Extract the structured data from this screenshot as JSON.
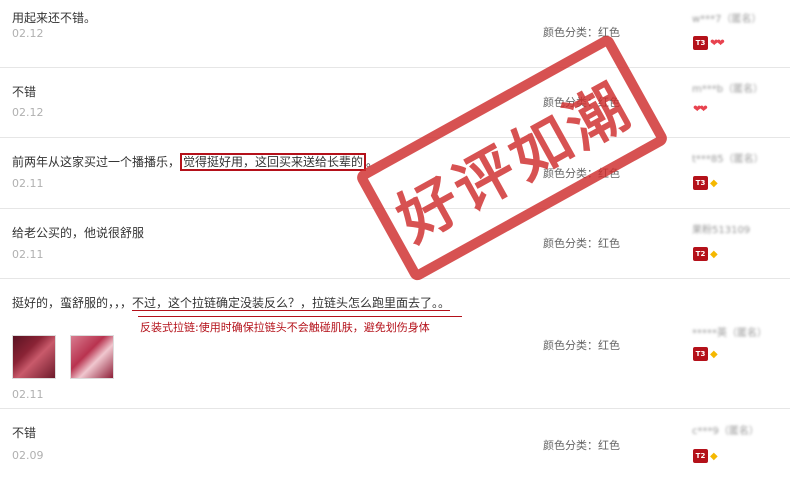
{
  "reviews": [
    {
      "content": "用起来还不错。",
      "date": "02.12",
      "sku": "颜色分类：红色",
      "user": "w***7（匿名）",
      "level": "T3",
      "badge": "hearts"
    },
    {
      "content": "不错",
      "date": "02.12",
      "sku": "颜色分类：红色",
      "user": "m***b（匿名）",
      "level": "",
      "badge": "hearts"
    },
    {
      "content_pre": "前两年从这家买过一个播播乐，",
      "content_boxed": "觉得挺好用，这回买来送给长辈的",
      "content_post": "。",
      "date": "02.11",
      "sku": "颜色分类：红色",
      "user": "t***85（匿名）",
      "level": "T3",
      "badge": "diamond"
    },
    {
      "content": "给老公买的，他说很舒服",
      "date": "02.11",
      "sku": "颜色分类：红色",
      "user": "果粉513109",
      "level": "T2",
      "badge": "diamond"
    },
    {
      "content_pre": "挺好的，蛮舒服的，，，",
      "content_underlined": "不过，这个拉链确定没装反么？，拉链头怎么跑里面去了。。",
      "reply": "反装式拉链:使用时确保拉链头不会触碰肌肤，避免划伤身体",
      "date": "02.11",
      "sku": "颜色分类：红色",
      "user": "*****英（匿名）",
      "level": "T3",
      "badge": "diamond"
    },
    {
      "content": "不错",
      "date": "02.09",
      "sku": "颜色分类：红色",
      "user": "c***9（匿名）",
      "level": "T2",
      "badge": "diamond"
    }
  ],
  "stamp": {
    "text": "好评如潮",
    "color": "#cf2d2d"
  },
  "colors": {
    "accent": "#b4111a",
    "date": "#b0b0b0"
  }
}
